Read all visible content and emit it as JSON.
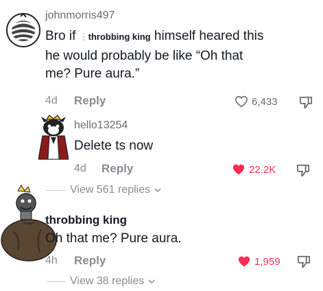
{
  "comments": [
    {
      "username": "johnmorris497",
      "text_before": "Bro if ",
      "mention": "throbbing king",
      "text_after": " himself heared this",
      "line2": "he would probably be like “Oh that",
      "line3": "me? Pure aura.”",
      "age": "4d",
      "reply_label": "Reply",
      "likes": "6,433",
      "liked": false
    },
    {
      "username": "hello13254",
      "text": "Delete ts now",
      "age": "4d",
      "reply_label": "Reply",
      "likes": "22.2K",
      "liked": true,
      "view_replies": "View 561 replies"
    },
    {
      "username": "throbbing king",
      "text": "Oh that me? Pure aura.",
      "age": "4h",
      "reply_label": "Reply",
      "likes": "1,959",
      "liked": true,
      "view_replies": "View 38 replies"
    }
  ],
  "colors": {
    "accent": "#fe2c55",
    "muted": "#8a8b91"
  },
  "icons": [
    "avatar-bandaged",
    "avatar-cat-king",
    "avatar-king-on-sack",
    "heart-icon",
    "dislike-icon",
    "chevron-down-icon"
  ]
}
